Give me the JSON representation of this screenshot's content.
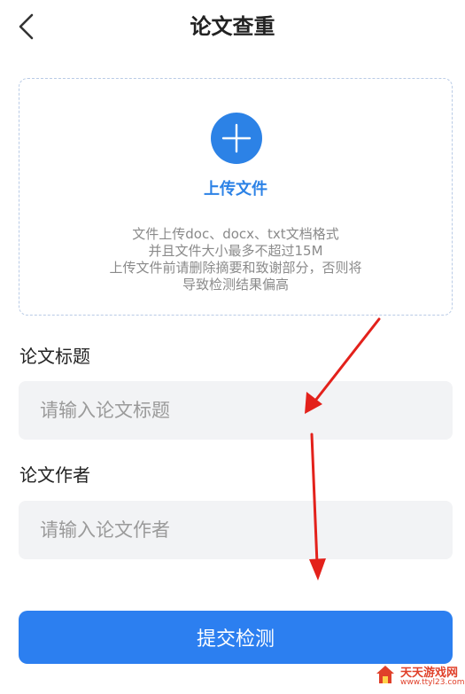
{
  "header": {
    "title": "论文查重"
  },
  "upload": {
    "label": "上传文件",
    "notes": [
      "文件上传doc、docx、txt文档格式",
      "并且文件大小最多不超过15M",
      "上传文件前请删除摘要和致谢部分，否则将",
      "导致检测结果偏高"
    ]
  },
  "form": {
    "title_label": "论文标题",
    "title_placeholder": "请输入论文标题",
    "author_label": "论文作者",
    "author_placeholder": "请输入论文作者"
  },
  "submit": {
    "label": "提交检测"
  },
  "watermark": {
    "name": "天天游戏网",
    "url": "www.ttyl23.com"
  },
  "colors": {
    "accent": "#2c82e6",
    "button": "#2c7ff0",
    "input_bg": "#f2f3f5",
    "annotation_arrow": "#e3211b"
  },
  "icons": {
    "back": "chevron-left-icon",
    "upload": "plus-icon"
  }
}
